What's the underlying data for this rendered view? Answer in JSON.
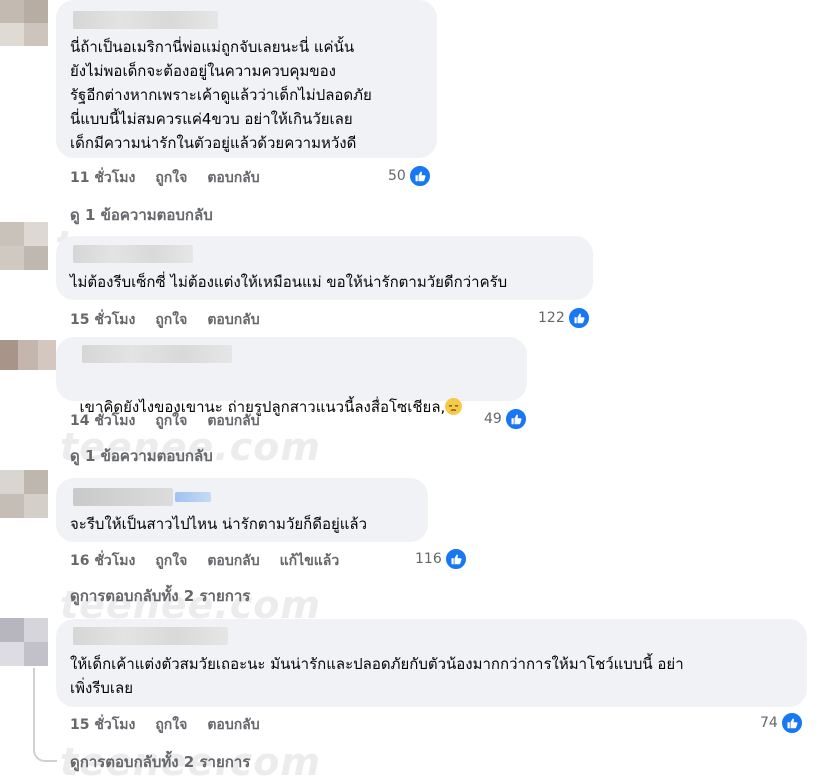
{
  "watermark": "teenee.com",
  "comments": [
    {
      "text": "นี่ถ้าเป็นอเมริกานี่พ่อแม่ถูกจับเลยนะนี่ แค่นั้น\nยังไม่พอเด็กจะต้องอยู่ในความควบคุมของ\nรัฐอีกต่างหากเพราะเค้าดูแล้วว่าเด็กไม่ปลอดภัย\nนี่แบบนี้ไม่สมควรแค่4ขวบ อย่าให้เกินวัยเลย\nเด็กมีความน่ารักในตัวอยู่แล้วด้วยความหวังดี",
      "time": "11 ชั่วโมง",
      "like": "ถูกใจ",
      "reply": "ตอบกลับ",
      "reactions": "50",
      "view_replies": "ดู 1 ข้อความตอบกลับ"
    },
    {
      "text": "ไม่ต้องรีบเซ็กซี่ ไม่ต้องแต่งให้เหมือนแม่ ขอให้น่ารักตามวัยดีกว่าครับ",
      "time": "15 ชั่วโมง",
      "like": "ถูกใจ",
      "reply": "ตอบกลับ",
      "reactions": "122"
    },
    {
      "text": "เขาคิดยังไงของเขานะ ถ่ายรูปลูกสาวแนวนี้ลงสื่อโซเชียล,",
      "time": "14 ชั่วโมง",
      "like": "ถูกใจ",
      "reply": "ตอบกลับ",
      "reactions": "49",
      "view_replies": "ดู 1 ข้อความตอบกลับ"
    },
    {
      "text": "จะรีบให้เป็นสาวไปไหน น่ารักตามวัยก็ดีอยู่แล้ว",
      "time": "16 ชั่วโมง",
      "like": "ถูกใจ",
      "reply": "ตอบกลับ",
      "edited": "แก้ไขแล้ว",
      "reactions": "116",
      "view_replies": "ดูการตอบกลับทั้ง 2 รายการ"
    },
    {
      "text": "ให้เด็กเค้าแต่งตัวสมวัยเถอะนะ มันน่ารักและปลอดภัยกับตัวน้องมากกว่าการให้มาโชว์แบบนี้ อย่า\nเพิ่งรีบเลย",
      "time": "15 ชั่วโมง",
      "like": "ถูกใจ",
      "reply": "ตอบกลับ",
      "reactions": "74",
      "view_replies": "ดูการตอบกลับทั้ง 2 รายการ"
    }
  ],
  "colors": {
    "bubble": "#f0f2f5",
    "meta": "#65676b",
    "like_blue": "#1877f2"
  },
  "icons": {
    "reaction": "like-thumb-icon",
    "emoji": "pensive-face-emoji"
  }
}
